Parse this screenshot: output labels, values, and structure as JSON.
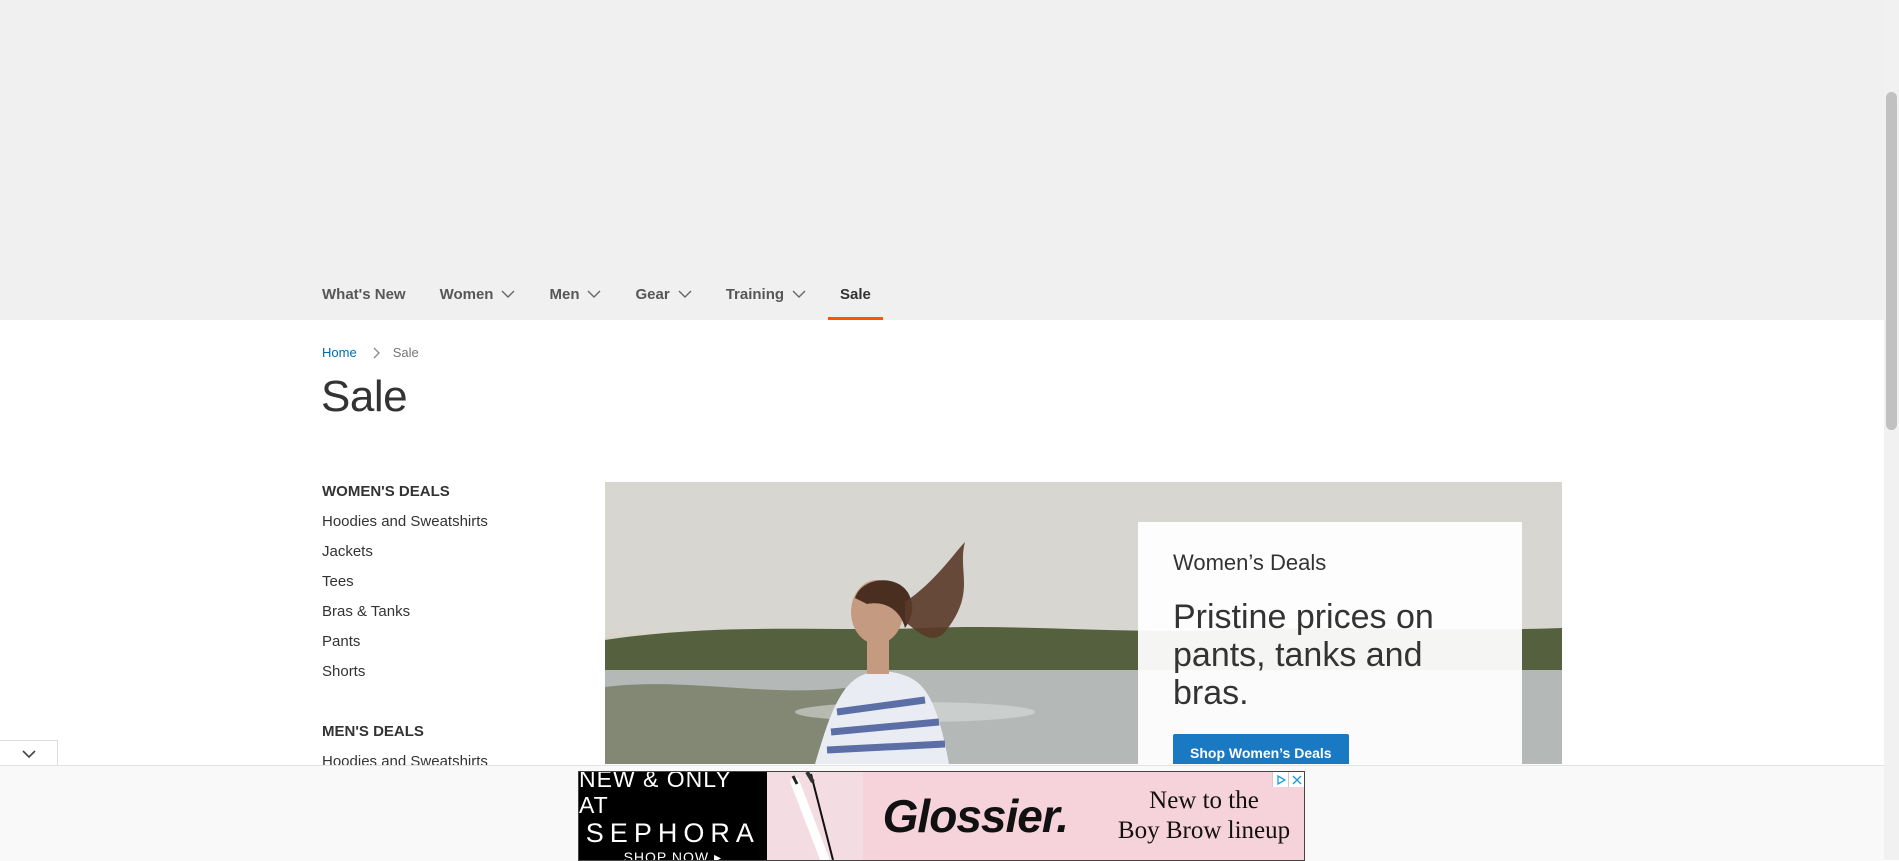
{
  "nav": {
    "items": [
      {
        "label": "What's New",
        "has_dropdown": false,
        "active": false
      },
      {
        "label": "Women",
        "has_dropdown": true,
        "active": false
      },
      {
        "label": "Men",
        "has_dropdown": true,
        "active": false
      },
      {
        "label": "Gear",
        "has_dropdown": true,
        "active": false
      },
      {
        "label": "Training",
        "has_dropdown": true,
        "active": false
      },
      {
        "label": "Sale",
        "has_dropdown": false,
        "active": true
      }
    ],
    "active_color": "#ff5501"
  },
  "breadcrumb": {
    "home": "Home",
    "current": "Sale"
  },
  "page": {
    "title": "Sale"
  },
  "sidebar": {
    "groups": [
      {
        "title": "WOMEN'S DEALS",
        "links": [
          "Hoodies and Sweatshirts",
          "Jackets",
          "Tees",
          "Bras & Tanks",
          "Pants",
          "Shorts"
        ]
      },
      {
        "title": "MEN'S DEALS",
        "links": [
          "Hoodies and Sweatshirts"
        ]
      }
    ]
  },
  "hero": {
    "eyebrow": "Women’s Deals",
    "headline": "Pristine prices on pants, tanks and bras.",
    "cta": "Shop Women’s Deals",
    "cta_color": "#1979c3"
  },
  "ad": {
    "sephora_line1": "NEW & ONLY AT",
    "sephora_line2": "SEPHORA",
    "sephora_line3": "SHOP NOW ▸",
    "brand": "Glossier.",
    "tagline_line1": "New to the",
    "tagline_line2": "Boy Brow lineup"
  },
  "icons": {
    "nav_dropdown": "chevron-down-icon",
    "breadcrumb_separator": "chevron-right-icon",
    "collapse": "chevron-down-icon",
    "adchoices": "adchoices-icon",
    "close": "close-icon"
  }
}
